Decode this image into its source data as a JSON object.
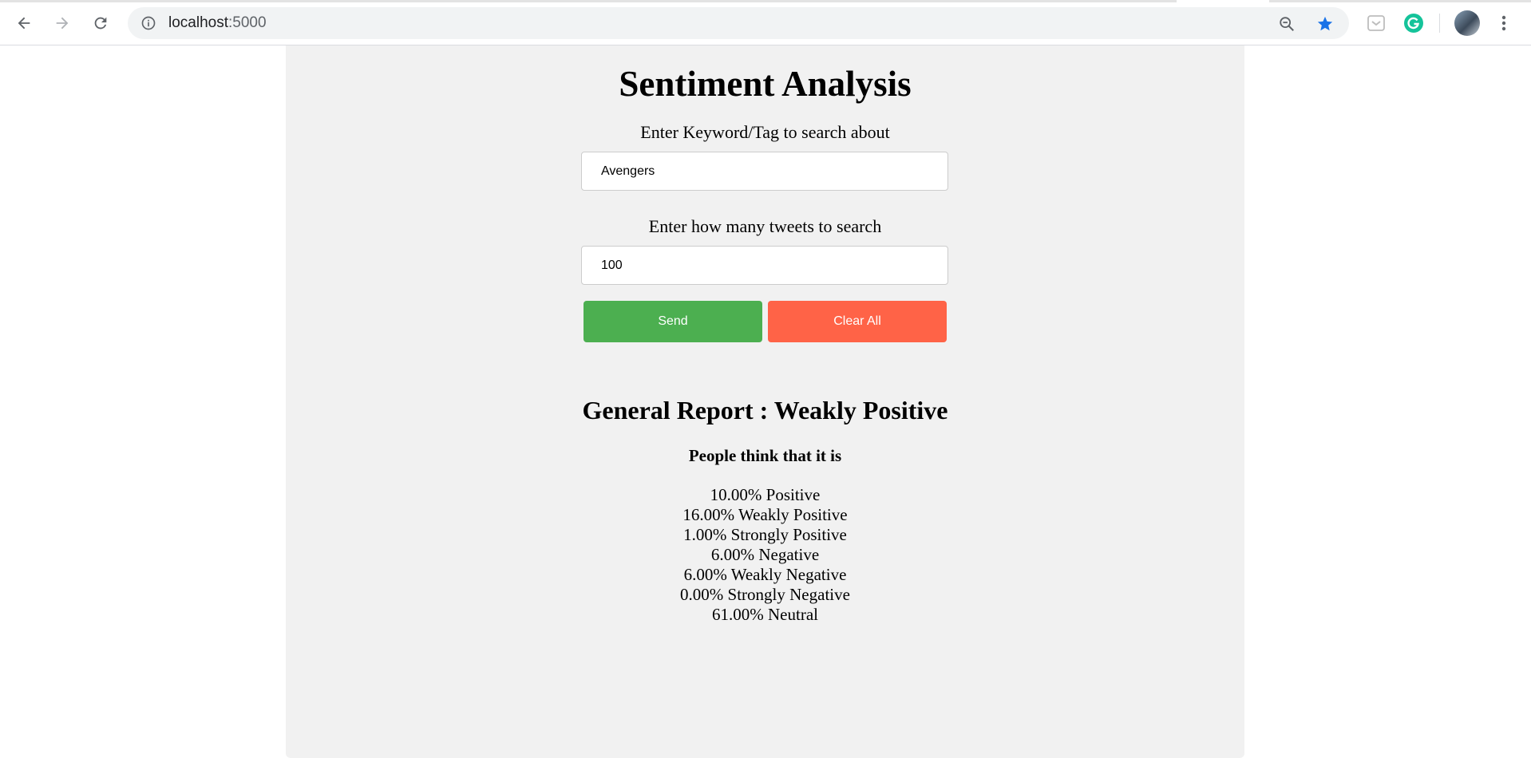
{
  "browser": {
    "url_host": "localhost",
    "url_port": ":5000",
    "icons": {
      "back": "back-arrow-icon",
      "forward": "forward-arrow-icon",
      "reload": "reload-icon",
      "site_info": "info-icon",
      "zoom": "zoom-out-icon",
      "bookmark": "star-icon",
      "extension1": "pocket-icon",
      "extension2": "grammarly-icon",
      "profile": "avatar",
      "menu": "kebab-menu-icon"
    },
    "colors": {
      "star": "#1a73e8",
      "grammarly": "#15c39a"
    }
  },
  "page": {
    "title": "Sentiment Analysis",
    "keyword_label": "Enter Keyword/Tag to search about",
    "keyword_value": "Avengers",
    "count_label": "Enter how many tweets to search",
    "count_value": "100",
    "send_label": "Send",
    "clear_label": "Clear All",
    "report_title": "General Report : Weakly Positive",
    "people_heading": "People think that it is",
    "results": [
      "10.00% Positive",
      "16.00% Weakly Positive",
      "1.00% Strongly Positive",
      "6.00% Negative",
      "6.00% Weakly Negative",
      "0.00% Strongly Negative",
      "61.00% Neutral"
    ],
    "colors": {
      "send": "#4caf50",
      "clear": "#ff6347",
      "panel": "#f1f1f1"
    }
  }
}
